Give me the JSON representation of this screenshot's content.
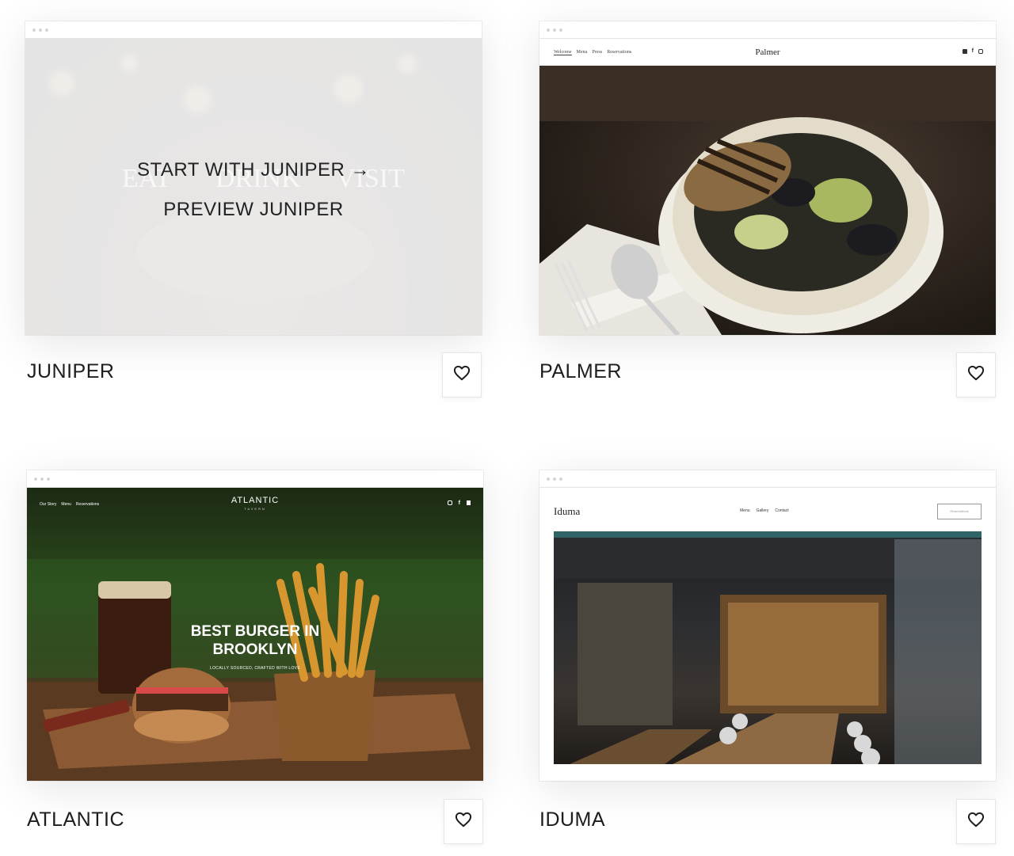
{
  "cards": [
    {
      "title": "JUNIPER",
      "start_label": "START WITH JUNIPER →",
      "preview_label": "PREVIEW JUNIPER",
      "ghost": {
        "word1": "EAT",
        "word2": "DRINK",
        "word3": "VISIT"
      }
    },
    {
      "title": "PALMER",
      "site": {
        "brand": "Palmer",
        "nav": [
          "Welcome",
          "Menu",
          "Press",
          "Reservations"
        ]
      }
    },
    {
      "title": "ATLANTIC",
      "site": {
        "brand": "ATLANTIC",
        "brand_sub": "TAVERN",
        "nav": [
          "Our Story",
          "Menu",
          "Reservations"
        ],
        "headline": "BEST BURGER IN BROOKLYN",
        "subline": "LOCALLY SOURCED, CRAFTED WITH LOVE"
      }
    },
    {
      "title": "IDUMA",
      "site": {
        "brand": "Iduma",
        "nav": [
          "Menu",
          "Gallery",
          "Contact"
        ],
        "cta": "Reservations"
      }
    }
  ],
  "colors": {
    "text": "#1d1d1d",
    "page_bg": "#ffffff",
    "frame_border": "#e4e4e4"
  },
  "icons": {
    "favorite": "heart-outline"
  }
}
